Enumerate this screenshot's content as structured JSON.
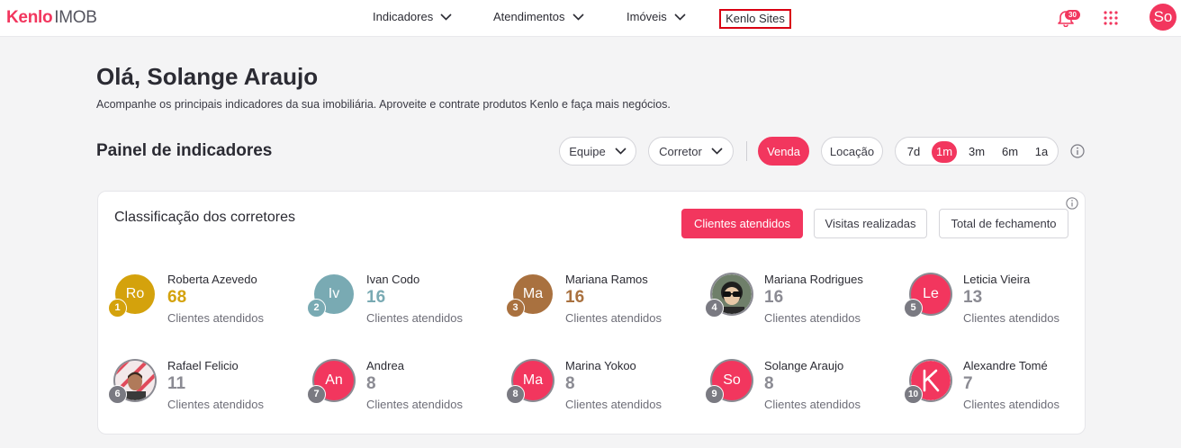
{
  "header": {
    "logo_brand": "Kenlo",
    "logo_sub": "IMOB",
    "nav": [
      {
        "label": "Indicadores"
      },
      {
        "label": "Atendimentos"
      },
      {
        "label": "Imóveis"
      }
    ],
    "sites_label": "Kenlo Sites",
    "notifications_count": "30",
    "user_initials": "So"
  },
  "greeting": "Olá, Solange Araujo",
  "subtitle": "Acompanhe os principais indicadores da sua imobiliária. Aproveite e contrate produtos Kenlo e faça mais negócios.",
  "panel": {
    "title": "Painel de indicadores",
    "team_select": "Equipe",
    "broker_select": "Corretor",
    "deal_types": [
      {
        "label": "Venda",
        "active": true
      },
      {
        "label": "Locação",
        "active": false
      }
    ],
    "periods": [
      {
        "label": "7d",
        "active": false
      },
      {
        "label": "1m",
        "active": true
      },
      {
        "label": "3m",
        "active": false
      },
      {
        "label": "6m",
        "active": false
      },
      {
        "label": "1a",
        "active": false
      }
    ]
  },
  "ranking": {
    "title": "Classificação dos corretores",
    "tabs": [
      {
        "label": "Clientes atendidos",
        "active": true
      },
      {
        "label": "Visitas realizadas",
        "active": false
      },
      {
        "label": "Total de fechamento",
        "active": false
      }
    ],
    "agents": [
      {
        "rank": "1",
        "name": "Roberta Azevedo",
        "value": "68",
        "label": "Clientes atendidos",
        "initials": "Ro",
        "avatar_color": "#d4a20c",
        "value_color": "#d4a20c",
        "rank_color": "#d4a20c",
        "avatar_type": "initials"
      },
      {
        "rank": "2",
        "name": "Ivan Codo",
        "value": "16",
        "label": "Clientes atendidos",
        "initials": "Iv",
        "avatar_color": "#79aab3",
        "value_color": "#79aab3",
        "rank_color": "#79aab3",
        "avatar_type": "initials"
      },
      {
        "rank": "3",
        "name": "Mariana Ramos",
        "value": "16",
        "label": "Clientes atendidos",
        "initials": "Ma",
        "avatar_color": "#a9713f",
        "value_color": "#a9713f",
        "rank_color": "#a9713f",
        "avatar_type": "initials"
      },
      {
        "rank": "4",
        "name": "Mariana Rodrigues",
        "value": "16",
        "label": "Clientes atendidos",
        "initials": "",
        "avatar_color": "#4a5a4a",
        "value_color": "#8b8b93",
        "rank_color": "#7a7a82",
        "avatar_type": "photo-cartoon"
      },
      {
        "rank": "5",
        "name": "Leticia Vieira",
        "value": "13",
        "label": "Clientes atendidos",
        "initials": "Le",
        "avatar_color": "#f2365e",
        "value_color": "#8b8b93",
        "rank_color": "#7a7a82",
        "avatar_type": "initials"
      },
      {
        "rank": "6",
        "name": "Rafael Felicio",
        "value": "11",
        "label": "Clientes atendidos",
        "initials": "",
        "avatar_color": "#e04a5a",
        "value_color": "#8b8b93",
        "rank_color": "#7a7a82",
        "avatar_type": "photo-person"
      },
      {
        "rank": "7",
        "name": "Andrea",
        "value": "8",
        "label": "Clientes atendidos",
        "initials": "An",
        "avatar_color": "#f2365e",
        "value_color": "#8b8b93",
        "rank_color": "#7a7a82",
        "avatar_type": "initials"
      },
      {
        "rank": "8",
        "name": "Marina Yokoo",
        "value": "8",
        "label": "Clientes atendidos",
        "initials": "Ma",
        "avatar_color": "#f2365e",
        "value_color": "#8b8b93",
        "rank_color": "#7a7a82",
        "avatar_type": "initials"
      },
      {
        "rank": "9",
        "name": "Solange Araujo",
        "value": "8",
        "label": "Clientes atendidos",
        "initials": "So",
        "avatar_color": "#f2365e",
        "value_color": "#8b8b93",
        "rank_color": "#7a7a82",
        "avatar_type": "initials"
      },
      {
        "rank": "10",
        "name": "Alexandre Tomé",
        "value": "7",
        "label": "Clientes atendidos",
        "initials": "",
        "avatar_color": "#f2365e",
        "value_color": "#8b8b93",
        "rank_color": "#7a7a82",
        "avatar_type": "kenlo-logo"
      }
    ]
  },
  "colors": {
    "accent": "#f2365e",
    "background": "#f4f4f5",
    "highlight_box": "#d90012"
  }
}
